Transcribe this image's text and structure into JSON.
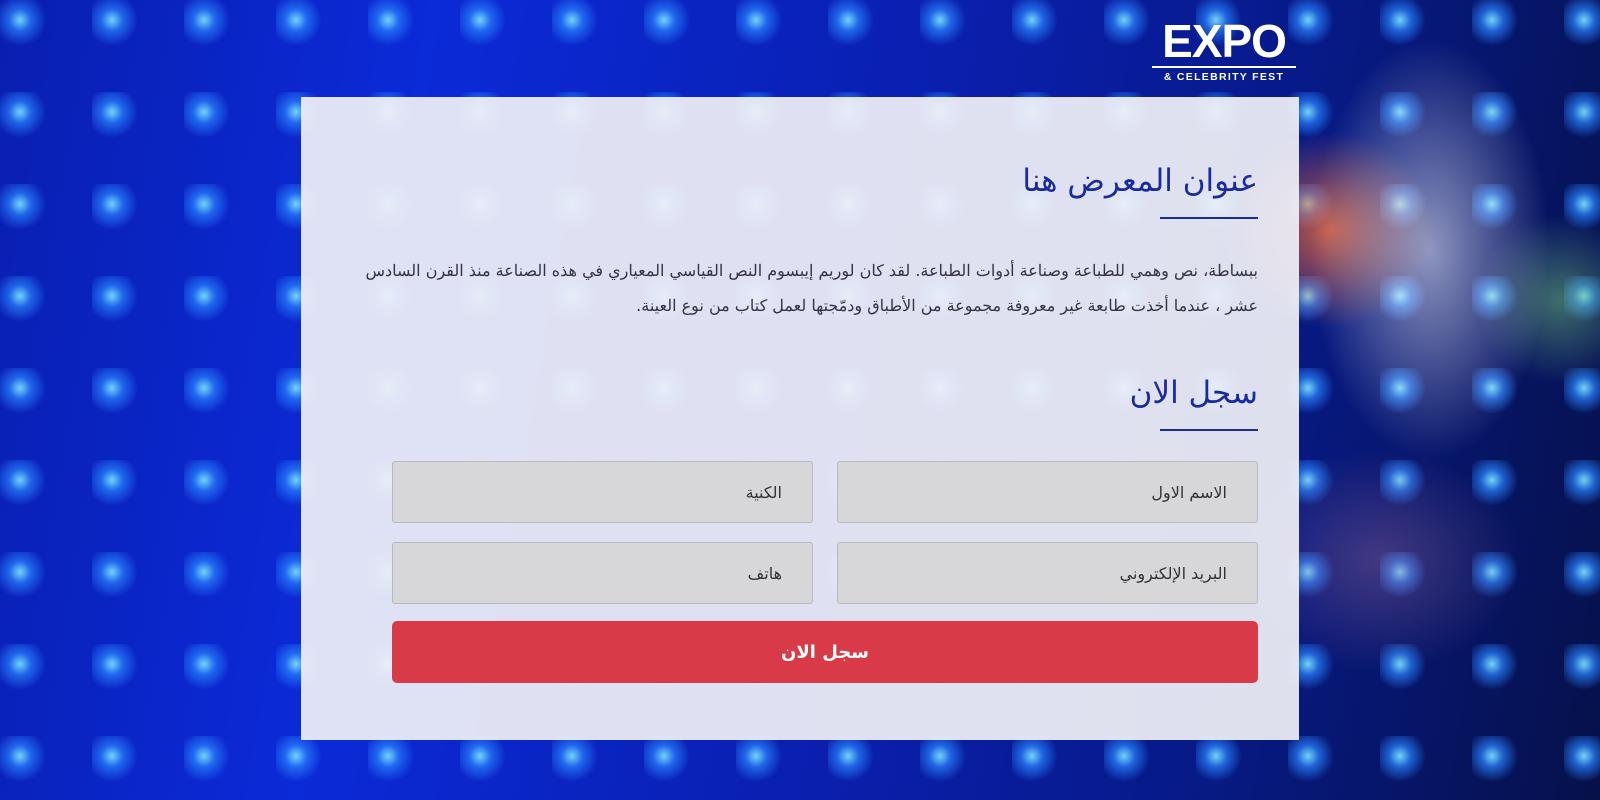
{
  "brand": {
    "logo_main": "EXPO",
    "logo_sub": "& CELEBRITY FEST"
  },
  "exhibition": {
    "title": "عنوان المعرض هنا",
    "description": "ببساطة، نص وهمي للطباعة وصناعة أدوات الطباعة. لقد كان لوريم إيبسوم النص القياسي المعياري في هذه الصناعة منذ القرن السادس عشر ، عندما أخذت طابعة غير معروفة مجموعة من الأطباق ودمّجتها لعمل كتاب من نوع العينة."
  },
  "register": {
    "title": "سجل الان",
    "first_name_placeholder": "الاسم الاول",
    "last_name_placeholder": "الكنية",
    "email_placeholder": "البريد الإلكتروني",
    "phone_placeholder": "هاتف",
    "submit_label": "سجل الان"
  },
  "colors": {
    "accent_blue": "#1a2aa0",
    "submit_red": "#d83a48",
    "field_bg": "#d7d7da",
    "card_bg": "#f0f0f6"
  }
}
